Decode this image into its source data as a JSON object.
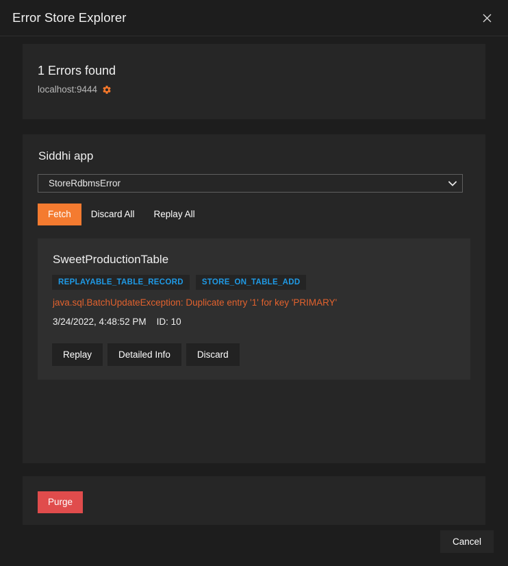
{
  "dialog": {
    "title": "Error Store Explorer",
    "close_icon": "close-icon"
  },
  "status": {
    "errors_found": "1 Errors found",
    "host": "localhost:9444",
    "settings_icon": "gear-icon"
  },
  "siddhi_app": {
    "section_title": "Siddhi app",
    "selected_app": "StoreRdbmsError",
    "options": [
      "StoreRdbmsError"
    ],
    "chevron_icon": "chevron-down-icon",
    "toolbar": {
      "fetch_label": "Fetch",
      "discard_all_label": "Discard All",
      "replay_all_label": "Replay All"
    },
    "errors": [
      {
        "name": "SweetProductionTable",
        "tags": [
          "REPLAYABLE_TABLE_RECORD",
          "STORE_ON_TABLE_ADD"
        ],
        "message": "java.sql.BatchUpdateException: Duplicate entry '1' for key 'PRIMARY'",
        "timestamp": "3/24/2022, 4:48:52 PM",
        "id": "ID: 10",
        "actions": {
          "replay_label": "Replay",
          "detailed_info_label": "Detailed Info",
          "discard_label": "Discard"
        }
      }
    ]
  },
  "purge": {
    "purge_label": "Purge"
  },
  "footer": {
    "cancel_label": "Cancel"
  },
  "colors": {
    "accent_orange": "#f47b30",
    "danger_red": "#e04c4c",
    "tag_blue": "#1f9ae6",
    "error_text": "#e2622e",
    "panel_bg": "#262626",
    "inner_card_bg": "#2f2f2f",
    "page_bg": "#1d1d1d"
  }
}
